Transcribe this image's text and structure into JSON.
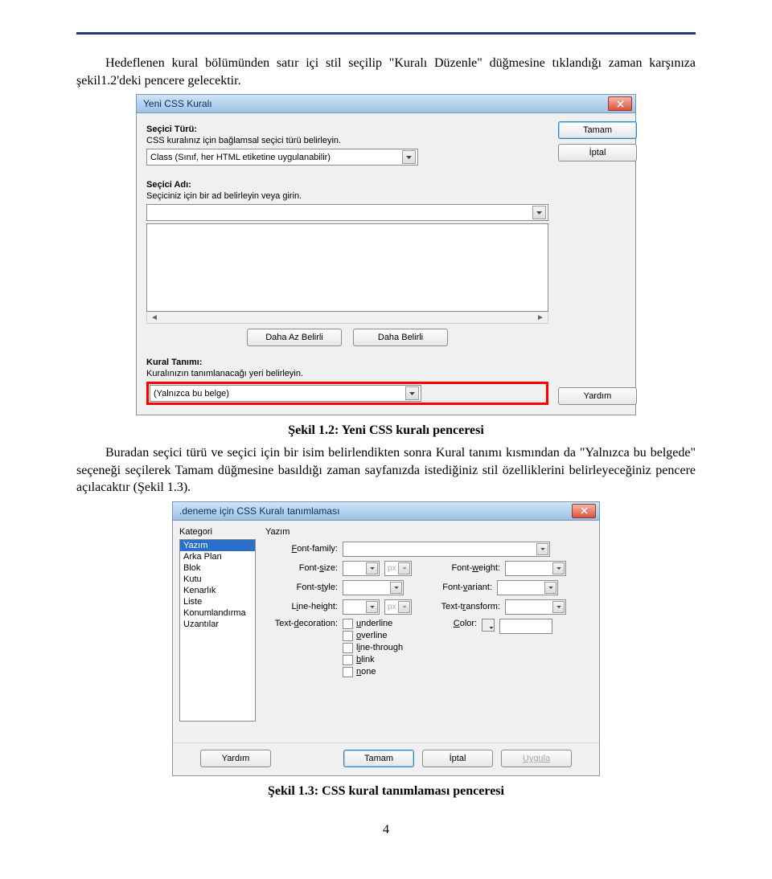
{
  "doc": {
    "para1": "Hedeflenen kural bölümünden satır içi stil seçilip \"Kuralı Düzenle\" düğmesine tıklandığı zaman karşınıza şekil1.2'deki pencere gelecektir.",
    "caption1": "Şekil 1.2: Yeni CSS kuralı penceresi",
    "para2": "Buradan seçici türü ve seçici için bir isim belirlendikten sonra Kural tanımı kısmından da \"Yalnızca bu belgede\" seçeneği seçilerek Tamam düğmesine basıldığı zaman sayfanızda istediğiniz stil özelliklerini belirleyeceğiniz pencere açılacaktır (Şekil 1.3).",
    "caption2": "Şekil 1.3: CSS kural tanımlaması penceresi",
    "pagenum": "4"
  },
  "dialog1": {
    "title": "Yeni CSS Kuralı",
    "sec1_label": "Seçici Türü:",
    "sec1_desc": "CSS kuralınız için bağlamsal seçici türü belirleyin.",
    "sec1_value": "Class (Sınıf, her HTML etiketine uygulanabilir)",
    "sec2_label": "Seçici Adı:",
    "sec2_desc": "Seçiciniz için bir ad belirleyin veya girin.",
    "btn_less": "Daha Az Belirli",
    "btn_more": "Daha Belirli",
    "sec3_label": "Kural Tanımı:",
    "sec3_desc": "Kuralınızın tanımlanacağı yeri belirleyin.",
    "sec3_value": "(Yalnızca bu belge)",
    "ok": "Tamam",
    "cancel": "İptal",
    "help": "Yardım"
  },
  "dialog2": {
    "title": ".deneme için CSS Kuralı tanımlaması",
    "cat_header": "Kategori",
    "categories": [
      "Yazım",
      "Arka Plan",
      "Blok",
      "Kutu",
      "Kenarlık",
      "Liste",
      "Konumlandırma",
      "Uzantılar"
    ],
    "main_header": "Yazım",
    "labels": {
      "ff": "Font-family:",
      "fz": "Font-size:",
      "fw": "Font-weight:",
      "fst": "Font-style:",
      "fv": "Font-variant:",
      "lh": "Line-height:",
      "tt": "Text-transform:",
      "td": "Text-decoration:",
      "col": "Color:"
    },
    "units": "px",
    "td_opts": [
      "underline",
      "overline",
      "line-through",
      "blink",
      "none"
    ],
    "help": "Yardım",
    "ok": "Tamam",
    "cancel": "İptal",
    "apply": "Uygula"
  }
}
